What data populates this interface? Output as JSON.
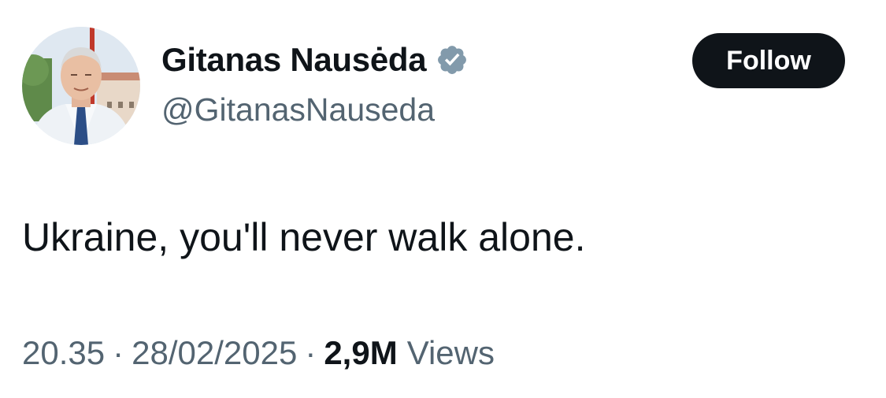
{
  "user": {
    "display_name": "Gitanas Nausėda",
    "handle": "@GitanasNauseda",
    "verified_badge_color": "#829aab",
    "avatar_icon": "profile-photo"
  },
  "follow_button": {
    "label": "Follow",
    "bg_color": "#0f1419",
    "text_color": "#ffffff"
  },
  "tweet": {
    "text": "Ukraine, you'll never walk alone."
  },
  "meta": {
    "time": "20.35",
    "separator": "·",
    "date": "28/02/2025",
    "views_count": "2,9M",
    "views_label": "Views"
  }
}
